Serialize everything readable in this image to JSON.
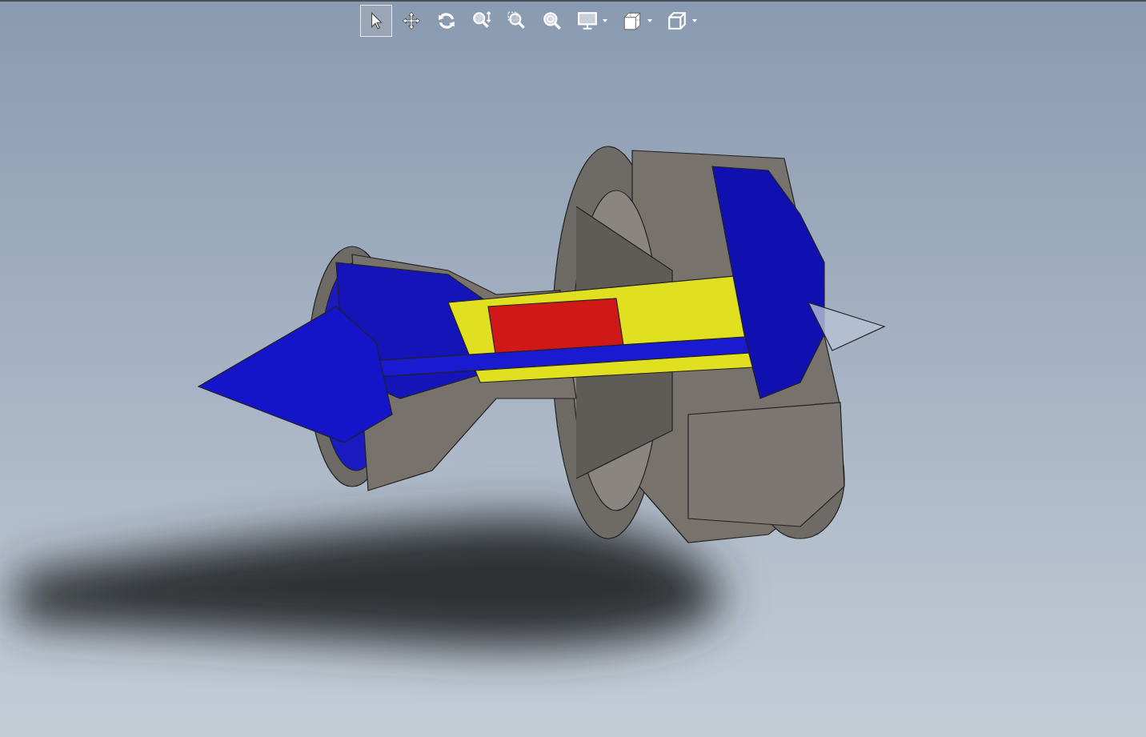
{
  "toolbar": {
    "tools": [
      {
        "kind": "select",
        "selected": true,
        "dropdown": false
      },
      {
        "kind": "pan",
        "selected": false,
        "dropdown": false
      },
      {
        "kind": "rotate",
        "selected": false,
        "dropdown": false
      },
      {
        "kind": "zoom-fit",
        "selected": false,
        "dropdown": false
      },
      {
        "kind": "zoom-area",
        "selected": false,
        "dropdown": false
      },
      {
        "kind": "zoom",
        "selected": false,
        "dropdown": false
      },
      {
        "kind": "display",
        "selected": false,
        "dropdown": true
      },
      {
        "kind": "section",
        "selected": false,
        "dropdown": true
      },
      {
        "kind": "view",
        "selected": false,
        "dropdown": true
      }
    ]
  }
}
